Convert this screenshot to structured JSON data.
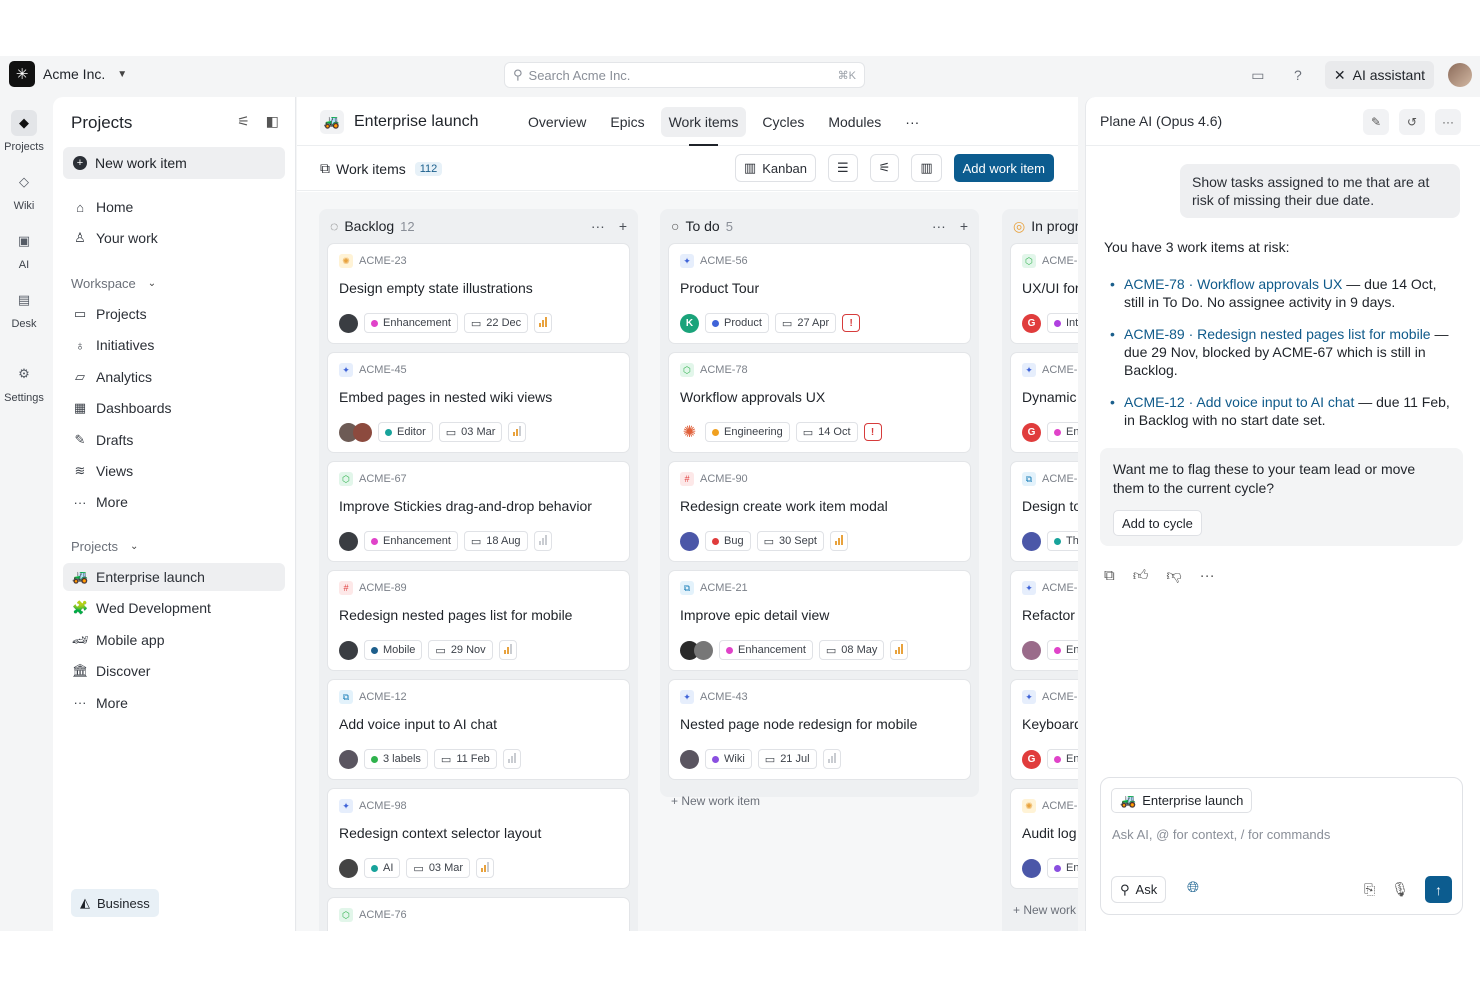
{
  "topbar": {
    "org_name": "Acme Inc.",
    "search_placeholder": "Search Acme Inc.",
    "search_shortcut": "⌘K",
    "ai_button": "AI assistant"
  },
  "rail": [
    {
      "label": "Projects",
      "icon": "projects-icon",
      "glyph": "◆",
      "active": true
    },
    {
      "label": "Wiki",
      "icon": "wiki-icon",
      "glyph": "◇",
      "active": false
    },
    {
      "label": "AI",
      "icon": "ai-icon",
      "glyph": "▣",
      "active": false
    },
    {
      "label": "Desk",
      "icon": "desk-icon",
      "glyph": "▤",
      "active": false
    },
    {
      "label": "Settings",
      "icon": "gear-icon",
      "glyph": "⚙",
      "active": false
    }
  ],
  "sidebar": {
    "title": "Projects",
    "new_item": "New work item",
    "top_nav": [
      {
        "label": "Home",
        "icon": "home-icon",
        "glyph": "⌂"
      },
      {
        "label": "Your work",
        "icon": "user-icon",
        "glyph": "♙"
      }
    ],
    "workspace_label": "Workspace",
    "workspace_nav": [
      {
        "label": "Projects",
        "icon": "briefcase-icon",
        "glyph": "▭"
      },
      {
        "label": "Initiatives",
        "icon": "bulb-icon",
        "glyph": "♁"
      },
      {
        "label": "Analytics",
        "icon": "analytics-icon",
        "glyph": "▱"
      },
      {
        "label": "Dashboards",
        "icon": "dashboard-icon",
        "glyph": "▦"
      },
      {
        "label": "Drafts",
        "icon": "pen-icon",
        "glyph": "✎"
      },
      {
        "label": "Views",
        "icon": "layers-icon",
        "glyph": "≋"
      },
      {
        "label": "More",
        "icon": "more-icon",
        "glyph": "···"
      }
    ],
    "projects_label": "Projects",
    "projects": [
      {
        "label": "Enterprise launch",
        "icon": "tractor-icon",
        "glyph": "🚜",
        "active": true
      },
      {
        "label": "Wed Development",
        "icon": "puzzle-icon",
        "glyph": "🧩",
        "active": false
      },
      {
        "label": "Mobile app",
        "icon": "racecar-icon",
        "glyph": "🏎",
        "active": false
      },
      {
        "label": "Discover",
        "icon": "building-icon",
        "glyph": "🏛",
        "active": false
      },
      {
        "label": "More",
        "icon": "more-icon",
        "glyph": "···",
        "active": false
      }
    ],
    "plan_badge": "Business"
  },
  "main": {
    "project_title": "Enterprise launch",
    "tabs": [
      "Overview",
      "Epics",
      "Work items",
      "Cycles",
      "Modules"
    ],
    "active_tab": "Work items",
    "work_items_label": "Work items",
    "work_items_count": "112",
    "layout_button": "Kanban",
    "add_button": "Add work item"
  },
  "columns": [
    {
      "name": "Backlog",
      "count": "12",
      "status": "backlog",
      "cards": [
        {
          "id": "ACME-23",
          "type": "sun",
          "title": "Design empty state illustrations",
          "avatars": [
            "#3a3d42"
          ],
          "label": "Enhancement",
          "label_color": "#e043c9",
          "date": "22 Dec",
          "priority": "high"
        },
        {
          "id": "ACME-45",
          "type": "sparkle",
          "title": "Embed pages in nested wiki views",
          "avatars": [
            "#6d5b55",
            "#8c4a3e"
          ],
          "label": "Editor",
          "label_color": "#18a39b",
          "date": "03 Mar",
          "priority": "medium"
        },
        {
          "id": "ACME-67",
          "type": "cube",
          "title": "Improve Stickies drag-and-drop behavior",
          "avatars": [
            "#3a3d42"
          ],
          "label": "Enhancement",
          "label_color": "#e043c9",
          "date": "18 Aug",
          "priority": "low"
        },
        {
          "id": "ACME-89",
          "type": "hash",
          "title": "Redesign nested pages list for mobile",
          "avatars": [
            "#3a3d42"
          ],
          "label": "Mobile",
          "label_color": "#1e5f8c",
          "date": "29 Nov",
          "priority": "medium"
        },
        {
          "id": "ACME-12",
          "type": "layers",
          "title": "Add voice input to AI chat",
          "avatars": [
            "#5a5560"
          ],
          "label": "3 labels",
          "label_color": "#2fb24c",
          "date": "11 Feb",
          "priority": "low"
        },
        {
          "id": "ACME-98",
          "type": "sparkle",
          "title": "Redesign context selector layout",
          "avatars": [
            "#444"
          ],
          "label": "AI",
          "label_color": "#18a39b",
          "date": "03 Mar",
          "priority": "medium"
        },
        {
          "id": "ACME-76",
          "type": "cube",
          "title": "",
          "avatars": [],
          "label": "",
          "label_color": "#ccc",
          "date": "",
          "priority": "low"
        }
      ]
    },
    {
      "name": "To do",
      "count": "5",
      "status": "todo",
      "cards": [
        {
          "id": "ACME-56",
          "type": "sparkle",
          "title": "Product Tour",
          "avatars": [
            "K"
          ],
          "label": "Product",
          "label_color": "#3f63d8",
          "date": "27 Apr",
          "priority": "urgent"
        },
        {
          "id": "ACME-78",
          "type": "cube",
          "title": "Workflow approvals UX",
          "avatars": [
            "burst"
          ],
          "label": "Engineering",
          "label_color": "#f0a020",
          "date": "14 Oct",
          "priority": "urgent"
        },
        {
          "id": "ACME-90",
          "type": "hash",
          "title": "Redesign create work item modal",
          "avatars": [
            "#4b57a8"
          ],
          "label": "Bug",
          "label_color": "#e03c3c",
          "date": "30 Sept",
          "priority": "high"
        },
        {
          "id": "ACME-21",
          "type": "layers",
          "title": "Improve epic detail view",
          "avatars": [
            "#2a2a2a",
            "#777"
          ],
          "label": "Enhancement",
          "label_color": "#e043c9",
          "date": "08 May",
          "priority": "high"
        },
        {
          "id": "ACME-43",
          "type": "sparkle",
          "title": "Nested page node redesign for mobile",
          "avatars": [
            "#5a5560"
          ],
          "label": "Wiki",
          "label_color": "#8a4fe0",
          "date": "21 Jul",
          "priority": "low"
        }
      ],
      "footer": "New work item"
    },
    {
      "name": "In progr",
      "count": "",
      "status": "progress",
      "cards": [
        {
          "id": "ACME-",
          "type": "cube",
          "title": "UX/UI for",
          "avatars": [
            "G"
          ],
          "label": "Int",
          "label_color": "#b040e0",
          "date": "",
          "priority": "none"
        },
        {
          "id": "ACME-",
          "type": "sparkle",
          "title": "Dynamic",
          "avatars": [
            "G"
          ],
          "label": "En",
          "label_color": "#e043c9",
          "date": "",
          "priority": "none"
        },
        {
          "id": "ACME-",
          "type": "layers",
          "title": "Design to",
          "avatars": [
            "#4b57a8"
          ],
          "label": "Th",
          "label_color": "#18a39b",
          "date": "",
          "priority": "none"
        },
        {
          "id": "ACME-",
          "type": "sparkle",
          "title": "Refactor",
          "avatars": [
            "#9a6b8a"
          ],
          "label": "En",
          "label_color": "#e043c9",
          "date": "",
          "priority": "none"
        },
        {
          "id": "ACME-",
          "type": "sparkle",
          "title": "Keyboard",
          "avatars": [
            "G"
          ],
          "label": "En",
          "label_color": "#e043c9",
          "date": "",
          "priority": "none"
        },
        {
          "id": "ACME-",
          "type": "sun",
          "title": "Audit log",
          "avatars": [
            "#4b57a8"
          ],
          "label": "En",
          "label_color": "#8a4fe0",
          "date": "",
          "priority": "none"
        }
      ],
      "footer": "New work"
    }
  ],
  "ai": {
    "title": "Plane AI (Opus 4.6)",
    "user_message": "Show tasks assigned to me that are at risk of missing their due date.",
    "intro": "You have 3 work items at risk:",
    "items": [
      {
        "link": "ACME-78 · Workflow approvals UX",
        "rest": " — due 14 Oct, still in To Do. No assignee activity in 9 days."
      },
      {
        "link": "ACME-89 · Redesign nested pages list for mobile",
        "rest": " — due 29 Nov, blocked by ACME-67 which is still in Backlog."
      },
      {
        "link": "ACME-12 · Add voice input to AI chat",
        "rest": " — due 11 Feb, in Backlog with no start date set."
      }
    ],
    "question": "Want me to flag these to your team lead or move them to the current cycle?",
    "cycle_button": "Add to cycle",
    "context_chip": "Enterprise launch",
    "placeholder": "Ask AI, @ for context, / for commands",
    "ask_button": "Ask"
  }
}
